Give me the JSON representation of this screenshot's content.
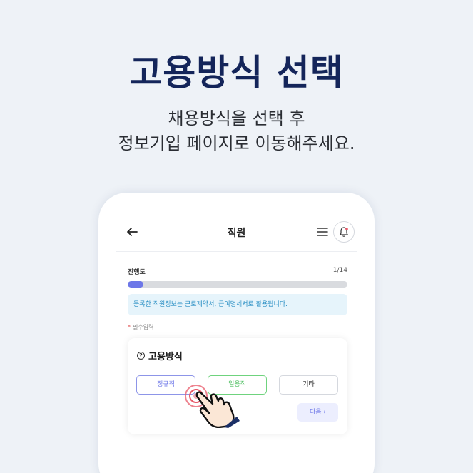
{
  "headline": "고용방식 선택",
  "subtitle_line1": "채용방식을 선택 후",
  "subtitle_line2": "정보기입 페이지로 이동해주세요.",
  "app": {
    "screen_title": "직원",
    "progress_label": "진행도",
    "progress_count": "1/14",
    "progress_fraction": 0.0714,
    "info_text": "등록한 직원정보는 근로계약서, 급여명세서로 활용됩니다.",
    "required_star": "*",
    "required_text": "필수입력",
    "card": {
      "help_glyph": "?",
      "title": "고용방식",
      "options": [
        "정규직",
        "일용직",
        "기타"
      ],
      "next_label": "다음",
      "next_chevron": "›"
    }
  },
  "colors": {
    "background": "#eef2f7",
    "headline": "#14255a",
    "accent": "#6d77e8",
    "info": "#2a8fc4",
    "green": "#4fbf61",
    "ripple": "#e85a6a"
  },
  "icons": {
    "back": "arrow-left-icon",
    "menu": "hamburger-menu-icon",
    "bell": "bell-icon",
    "help": "question-circle-icon",
    "pointer": "hand-pointer-icon"
  }
}
